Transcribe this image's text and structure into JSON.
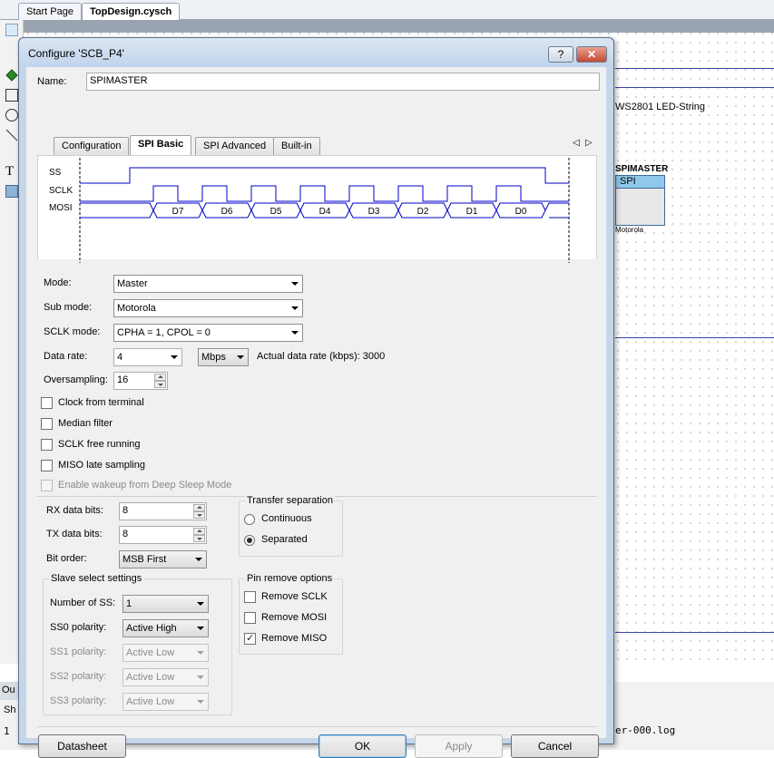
{
  "ide": {
    "tabs": [
      "Start Page",
      "TopDesign.cysch"
    ],
    "canvas_label": "WS2801 LED-String",
    "component": {
      "title": "SPIMASTER",
      "header": "SPI",
      "footer": "Motorola"
    },
    "output_tab": "Ou",
    "sh_tab": "Sh",
    "log_text": "er-000.log",
    "log_number": "1"
  },
  "dialog": {
    "title": "Configure 'SCB_P4'",
    "help_label": "?",
    "close_label": "✕",
    "name_label": "Name:",
    "name_value": "SPIMASTER",
    "tabs": [
      "Configuration",
      "SPI Basic",
      "SPI Advanced",
      "Built-in"
    ],
    "active_tab": "SPI Basic",
    "timing": {
      "signals": [
        "SS",
        "SCLK",
        "MOSI"
      ],
      "bits": [
        "D7",
        "D6",
        "D5",
        "D4",
        "D3",
        "D2",
        "D1",
        "D0"
      ]
    },
    "mode": {
      "label": "Mode:",
      "value": "Master"
    },
    "sub_mode": {
      "label": "Sub mode:",
      "value": "Motorola"
    },
    "sclk_mode": {
      "label": "SCLK mode:",
      "value": "CPHA = 1, CPOL = 0"
    },
    "data_rate": {
      "label": "Data rate:",
      "value": "4",
      "unit": "Mbps",
      "actual": "Actual data rate (kbps): 3000"
    },
    "oversampling": {
      "label": "Oversampling:",
      "value": "16"
    },
    "checkboxes": [
      {
        "label": "Clock from terminal",
        "checked": false,
        "enabled": true
      },
      {
        "label": "Median filter",
        "checked": false,
        "enabled": true
      },
      {
        "label": "SCLK free running",
        "checked": false,
        "enabled": true
      },
      {
        "label": "MISO late sampling",
        "checked": false,
        "enabled": true
      },
      {
        "label": "Enable wakeup from Deep Sleep Mode",
        "checked": false,
        "enabled": false
      }
    ],
    "rx_bits": {
      "label": "RX data bits:",
      "value": "8"
    },
    "tx_bits": {
      "label": "TX data bits:",
      "value": "8"
    },
    "bit_order": {
      "label": "Bit order:",
      "value": "MSB First"
    },
    "transfer_separation": {
      "title": "Transfer separation",
      "options": [
        {
          "label": "Continuous",
          "selected": false
        },
        {
          "label": "Separated",
          "selected": true
        }
      ]
    },
    "slave_select": {
      "title": "Slave select settings",
      "num_ss": {
        "label": "Number of SS:",
        "value": "1"
      },
      "ss0": {
        "label": "SS0 polarity:",
        "value": "Active High"
      },
      "ss1": {
        "label": "SS1 polarity:",
        "value": "Active Low"
      },
      "ss2": {
        "label": "SS2 polarity:",
        "value": "Active Low"
      },
      "ss3": {
        "label": "SS3 polarity:",
        "value": "Active Low"
      }
    },
    "pin_remove": {
      "title": "Pin remove options",
      "options": [
        {
          "label": "Remove SCLK",
          "checked": false
        },
        {
          "label": "Remove MOSI",
          "checked": false
        },
        {
          "label": "Remove MISO",
          "checked": true
        }
      ]
    },
    "buttons": {
      "datasheet": "Datasheet",
      "ok": "OK",
      "apply": "Apply",
      "cancel": "Cancel"
    }
  }
}
